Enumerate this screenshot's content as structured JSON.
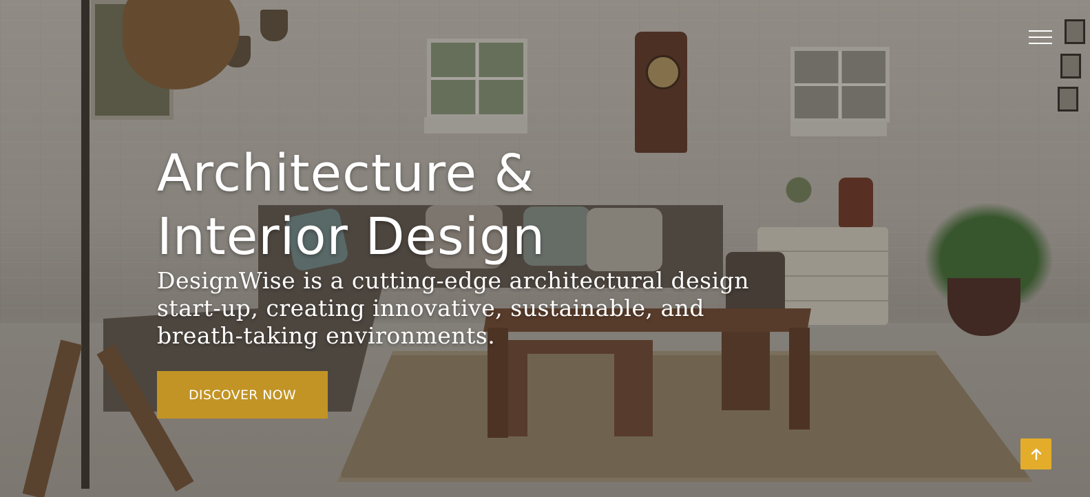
{
  "hero": {
    "headline_line1": "Architecture &",
    "headline_line2": "Interior Design",
    "subtitle": "DesignWise is a cutting-edge architectural design start-up, creating innovative, sustainable, and breath-taking environments.",
    "cta_label": "DISCOVER NOW"
  },
  "nav": {
    "menu_icon": "hamburger-menu-icon"
  },
  "scroll_top": {
    "icon": "arrow-up-icon"
  },
  "colors": {
    "accent": "#c29425",
    "scroll_top_bg": "#e3ad2b",
    "text": "#ffffff"
  }
}
